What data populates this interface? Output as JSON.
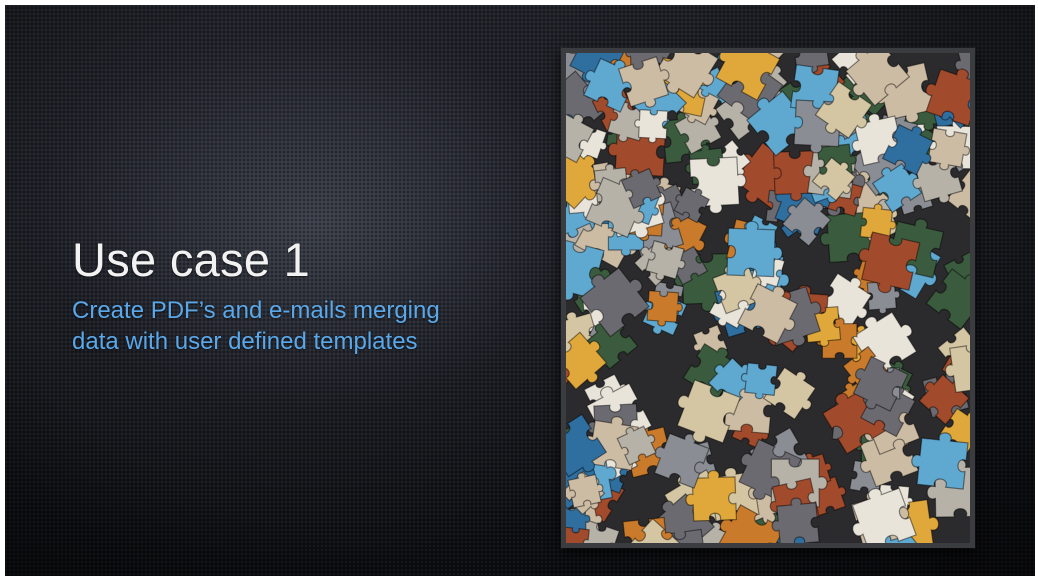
{
  "slide": {
    "title": "Use case 1",
    "subtitle": "Create PDF’s and e-mails merging data with user defined templates"
  },
  "image": {
    "depicts": "jigsaw-puzzle-pieces",
    "palette": [
      "#e9e4da",
      "#cdbca4",
      "#5fa8cf",
      "#e0a83a",
      "#a14a2c",
      "#3a5b3d",
      "#8a8d93",
      "#b7b2a8",
      "#d4c6a3",
      "#2f6fa0",
      "#c97a2a",
      "#6b6a70"
    ]
  }
}
